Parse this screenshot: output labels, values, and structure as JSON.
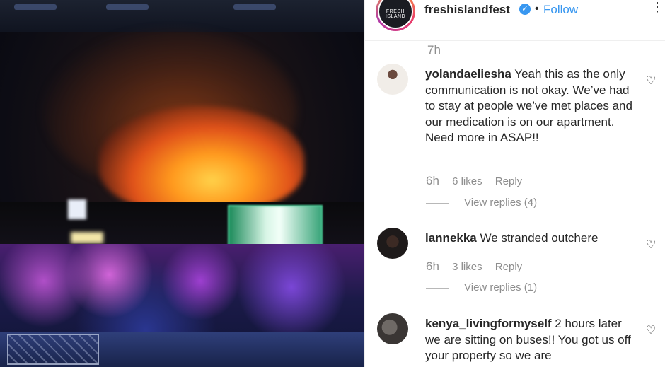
{
  "post": {
    "account": "freshislandfest",
    "follow_label": "Follow",
    "separator": "•",
    "more_icon": "⋮",
    "logo_text": "FRESH ISLAND",
    "time": "7h"
  },
  "comments": [
    {
      "user": "yolandaeliesha",
      "text": " Yeah this as the only communication is not okay. We’ve had to stay at people we’ve met places and our medication is on our apartment. Need more in ASAP!!",
      "time": "6h",
      "likes": "6 likes",
      "reply_label": "Reply",
      "view_replies": "View replies (4)"
    },
    {
      "user": "lannekka",
      "text": " We stranded outchere",
      "time": "6h",
      "likes": "3 likes",
      "reply_label": "Reply",
      "view_replies": "View replies (1)"
    },
    {
      "user": "kenya_livingformyself",
      "text": " 2 hours later we are sitting on buses!! You got us off your property so we are"
    }
  ],
  "icons": {
    "verified": "verified-badge-icon",
    "heart": "heart-outline-icon",
    "more": "more-options-icon"
  },
  "colors": {
    "link_blue": "#3897f0",
    "text": "#262626",
    "muted": "#8e8e8e"
  }
}
